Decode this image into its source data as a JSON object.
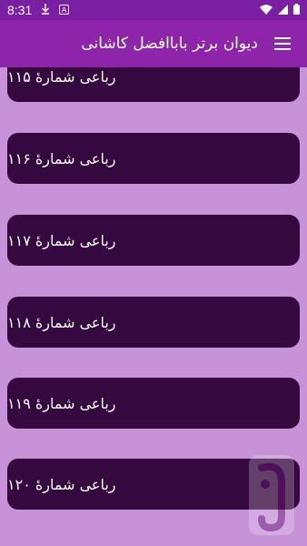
{
  "status_bar": {
    "time": "8:31",
    "icons": [
      "download-icon",
      "a-icon",
      "wifi-icon",
      "signal-icon",
      "battery-icon"
    ]
  },
  "app_bar": {
    "title": "دیوان برتر باباافضل کاشانی",
    "menu_icon": "hamburger-menu-icon"
  },
  "list": {
    "items": [
      {
        "label": "رباعی شمارهٔ ۱۱۵"
      },
      {
        "label": "رباعی شمارهٔ ۱۱۶"
      },
      {
        "label": "رباعی شمارهٔ ۱۱۷"
      },
      {
        "label": "رباعی شمارهٔ ۱۱۸"
      },
      {
        "label": "رباعی شمارهٔ ۱۱۹"
      },
      {
        "label": "رباعی شمارهٔ ۱۲۰"
      }
    ]
  },
  "colors": {
    "status_bar": "#7b1fa2",
    "app_bar": "#8e24aa",
    "background": "#c792d8",
    "item_bg": "#35093f",
    "text": "#ffffff"
  }
}
